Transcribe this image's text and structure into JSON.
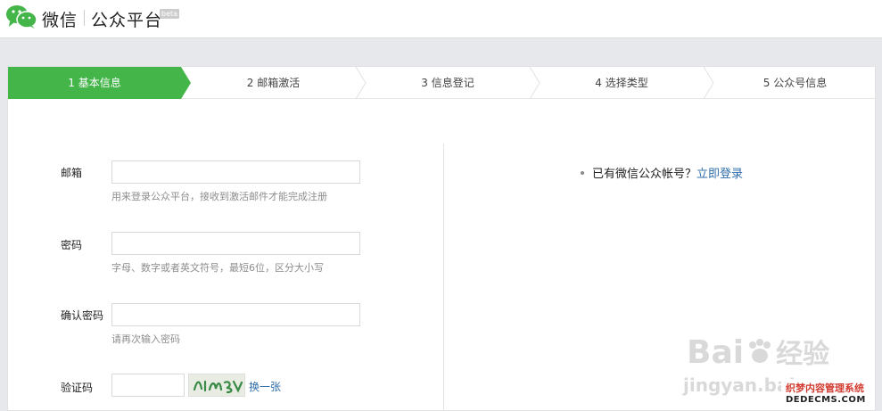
{
  "header": {
    "brand": "微信",
    "subtitle": "公众平台",
    "badge": "beta"
  },
  "steps": [
    {
      "label": "1 基本信息",
      "active": true
    },
    {
      "label": "2 邮箱激活",
      "active": false
    },
    {
      "label": "3 信息登记",
      "active": false
    },
    {
      "label": "4 选择类型",
      "active": false
    },
    {
      "label": "5 公众号信息",
      "active": false
    }
  ],
  "colors": {
    "active_step": "#44b549",
    "link": "#2f6ea8"
  },
  "form": {
    "email": {
      "label": "邮箱",
      "value": "",
      "hint": "用来登录公众平台，接收到激活邮件才能完成注册"
    },
    "password": {
      "label": "密码",
      "value": "",
      "hint": "字母、数字或者英文符号，最短6位，区分大小写"
    },
    "confirm": {
      "label": "确认密码",
      "value": "",
      "hint": "请再次输入密码"
    },
    "captcha": {
      "label": "验证码",
      "value": "",
      "refresh": "换一张"
    }
  },
  "side": {
    "text": "已有微信公众帐号？",
    "login_link": "立即登录"
  },
  "watermark": {
    "logo": "Bai",
    "logo_suffix": "经验",
    "url": "jingyan.bai",
    "badge_title": "织梦内容管理系统",
    "badge_domain": "DEDECMS.COM"
  }
}
